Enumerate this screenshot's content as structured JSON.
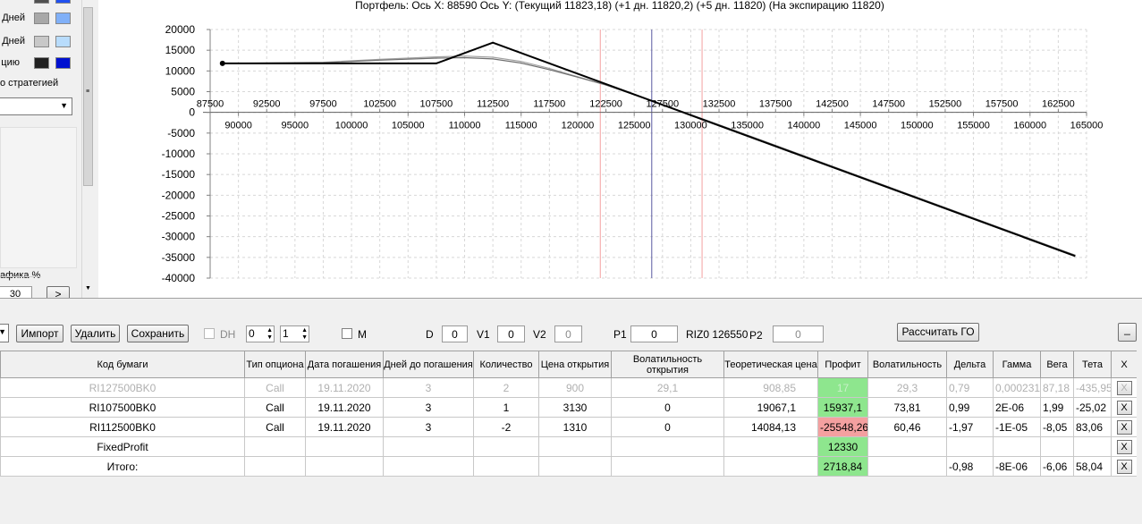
{
  "left_panel": {
    "rows": [
      {
        "label": "Дней",
        "c1": "#a8a8a8",
        "c2": "#80b0f8"
      },
      {
        "label": "Дней",
        "c1": "#c8c8c8",
        "c2": "#b8dcfc"
      },
      {
        "label": "цию",
        "c1": "#202020",
        "c2": "#0010d0"
      }
    ],
    "strategy_label": "о стратегией",
    "chart_pct_label": "афика %",
    "chart_pct_value": "30",
    "next_label": ">"
  },
  "chart": {
    "title": "Портфель: Ось X: 88590 Ось Y:  (Текущий 11823,18)  (+1 дн. 11820,2)  (+5 дн. 11820)  (На экспирацию 11820)",
    "y_ticks": [
      "20000",
      "15000",
      "10000",
      "5000",
      "0",
      "-5000",
      "-10000",
      "-15000",
      "-20000",
      "-25000",
      "-30000",
      "-35000",
      "-40000"
    ],
    "x_ticks_top": [
      "87500",
      "92500",
      "97500",
      "102500",
      "107500",
      "112500",
      "117500",
      "122500",
      "127500",
      "132500",
      "137500",
      "142500",
      "147500",
      "152500",
      "157500",
      "162500"
    ],
    "x_ticks_bottom": [
      "90000",
      "95000",
      "100000",
      "105000",
      "110000",
      "115000",
      "120000",
      "125000",
      "130000",
      "135000",
      "140000",
      "145000",
      "150000",
      "155000",
      "160000",
      "165000"
    ]
  },
  "chart_data": {
    "type": "line",
    "xlim": [
      87500,
      165000
    ],
    "ylim": [
      -40000,
      20000
    ],
    "grid": true,
    "vertical_lines": [
      {
        "x": 122000,
        "color": "#f4a0a0"
      },
      {
        "x": 126550,
        "color": "#5a5aa0"
      },
      {
        "x": 131000,
        "color": "#f4a0a0"
      }
    ],
    "series": [
      {
        "color": "#a0a0a0",
        "x": [
          88590,
          97500,
          102500,
          107500,
          110000,
          112500,
          115000,
          117500,
          120000,
          122500,
          127500,
          132500,
          137500,
          142500,
          147500,
          152500,
          157500,
          162500,
          164000
        ],
        "y": [
          11820,
          12100,
          12800,
          13400,
          13600,
          13300,
          12300,
          10600,
          8600,
          6600,
          1900,
          -3000,
          -8000,
          -13000,
          -18000,
          -23000,
          -28000,
          -33000,
          -34500
        ]
      },
      {
        "color": "#707070",
        "x": [
          88590,
          97500,
          102500,
          107500,
          110000,
          112500,
          115000,
          117500,
          120000,
          122500,
          127500,
          132500,
          137500,
          142500,
          147500,
          152500,
          157500,
          162500,
          164000
        ],
        "y": [
          11820,
          12000,
          12600,
          13100,
          13200,
          12900,
          11900,
          10300,
          8500,
          6600,
          1900,
          -3000,
          -8000,
          -13000,
          -18000,
          -23000,
          -28000,
          -33000,
          -34500
        ]
      },
      {
        "color": "#000000",
        "x": [
          88590,
          107500,
          112500,
          164000
        ],
        "y": [
          11820,
          11820,
          16820,
          -34680
        ]
      }
    ]
  },
  "toolbar": {
    "import_label": "Импорт",
    "delete_label": "Удалить",
    "save_label": "Сохранить",
    "dh_label": "DH",
    "spin1": "0",
    "spin2": "1",
    "m_label": "M",
    "d_label": "D",
    "d_value": "0",
    "v1_label": "V1",
    "v1_value": "0",
    "v2_label": "V2",
    "v2_value": "0",
    "p1_label": "P1",
    "p1_value": "0",
    "riz_label": "RIZ0 126550",
    "p2_label": "P2",
    "p2_value": "0",
    "calc_label": "Рассчитать ГО",
    "minimize_label": "_"
  },
  "table": {
    "headers": [
      "Код бумаги",
      "Тип опциона",
      "Дата погашения",
      "Дней до погашения",
      "Количество",
      "Цена открытия",
      "Волатильность открытия",
      "Теоретическая цена",
      "Профит",
      "Волатильность",
      "Дельта",
      "Гамма",
      "Вега",
      "Тета",
      "X"
    ],
    "rows": [
      {
        "cells": [
          "RI127500BK0",
          "Call",
          "19.11.2020",
          "3",
          "2",
          "900",
          "29,1",
          "908,85",
          "17",
          "29,3",
          "0,79",
          "0,000231",
          "87,18",
          "-435,95"
        ],
        "dim": true,
        "profit_color": "green",
        "x": "X"
      },
      {
        "cells": [
          "RI107500BK0",
          "Call",
          "19.11.2020",
          "3",
          "1",
          "3130",
          "0",
          "19067,1",
          "15937,1",
          "73,81",
          "0,99",
          "2E-06",
          "1,99",
          "-25,02"
        ],
        "dim": false,
        "profit_color": "green",
        "x": "X"
      },
      {
        "cells": [
          "RI112500BK0",
          "Call",
          "19.11.2020",
          "3",
          "-2",
          "1310",
          "0",
          "14084,13",
          "-25548,26",
          "60,46",
          "-1,97",
          "-1E-05",
          "-8,05",
          "83,06"
        ],
        "dim": false,
        "profit_color": "red",
        "x": "X"
      },
      {
        "cells": [
          "FixedProfit",
          "",
          "",
          "",
          "",
          "",
          "",
          "",
          "12330",
          "",
          "",
          "",
          "",
          ""
        ],
        "dim": false,
        "profit_color": "green",
        "x": "X"
      },
      {
        "cells": [
          "Итого:",
          "",
          "",
          "",
          "",
          "",
          "",
          "",
          "2718,84",
          "",
          "-0,98",
          "-8E-06",
          "-6,06",
          "58,04"
        ],
        "dim": false,
        "profit_color": "green",
        "x": "X"
      }
    ]
  }
}
